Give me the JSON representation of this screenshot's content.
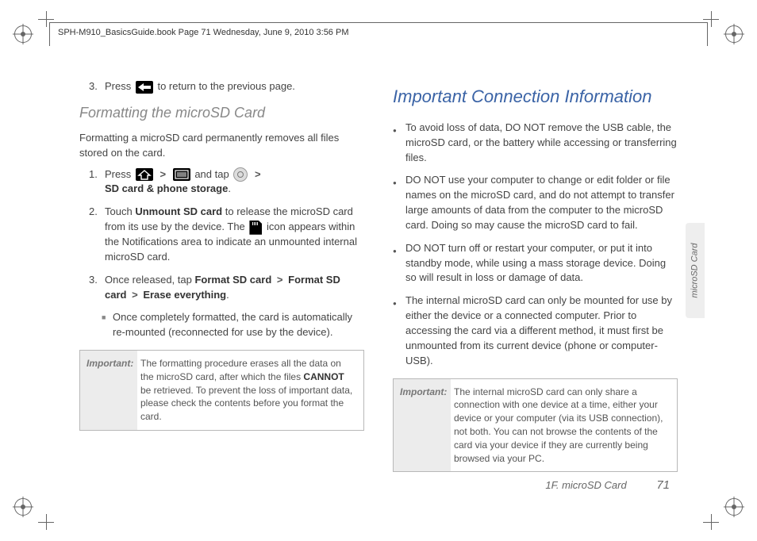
{
  "meta": {
    "header_line": "SPH-M910_BasicsGuide.book  Page 71  Wednesday, June 9, 2010  3:56 PM"
  },
  "left": {
    "step3_prefix": "Press ",
    "step3_suffix": " to return to the previous page.",
    "step3_num": "3.",
    "h3": "Formatting the microSD Card",
    "intro": "Formatting a microSD card permanently removes all files stored on the card.",
    "f1_num": "1.",
    "f1_a": "Press ",
    "f1_b": " and tap ",
    "f1_c": "SD card & phone storage",
    "f1_d": ".",
    "f2_num": "2.",
    "f2_a": "Touch ",
    "f2_b": "Unmount SD card",
    "f2_c": " to release the microSD card from its use by the device. The ",
    "f2_d": " icon appears within the Notifications area to indicate an unmounted internal microSD card.",
    "f3_num": "3.",
    "f3_a": "Once released, tap ",
    "f3_b": "Format SD card",
    "f3_c": "Format SD card",
    "f3_d": "Erase everything",
    "f3_e": ".",
    "sub_a": "Once completely formatted, the card is automatically re-mounted (reconnected for use by the device).",
    "important_label": "Important:",
    "important_body_a": "The formatting procedure erases all the data on the microSD card, after which the files ",
    "important_body_b": "CANNOT",
    "important_body_c": " be retrieved. To prevent the loss of important data, please check the contents before you format the card."
  },
  "right": {
    "h2": "Important Connection Information",
    "bullets": [
      "To avoid loss of data, DO NOT remove the USB cable, the microSD card, or the battery while accessing or transferring files.",
      "DO NOT use your computer to change or edit folder or file names on the microSD card, and do not attempt to transfer large amounts of data from the computer to the microSD card. Doing so may cause the microSD card to fail.",
      "DO NOT turn off or restart your computer, or put it into standby mode, while using a mass storage device. Doing so will result in loss or damage of data.",
      "The internal microSD card can only be mounted for use by either the device or a connected computer. Prior to accessing the card via a different method, it must first be unmounted from its current device (phone or computer-USB)."
    ],
    "important_label": "Important:",
    "important_body": "The internal microSD card can only share a connection with one device at a time, either your device or your computer (via its USB connection), not both. You can not browse the contents of the card via your device if they are currently being browsed via your PC."
  },
  "side_tab": "microSD Card",
  "footer": {
    "section": "1F. microSD Card",
    "page": "71"
  }
}
